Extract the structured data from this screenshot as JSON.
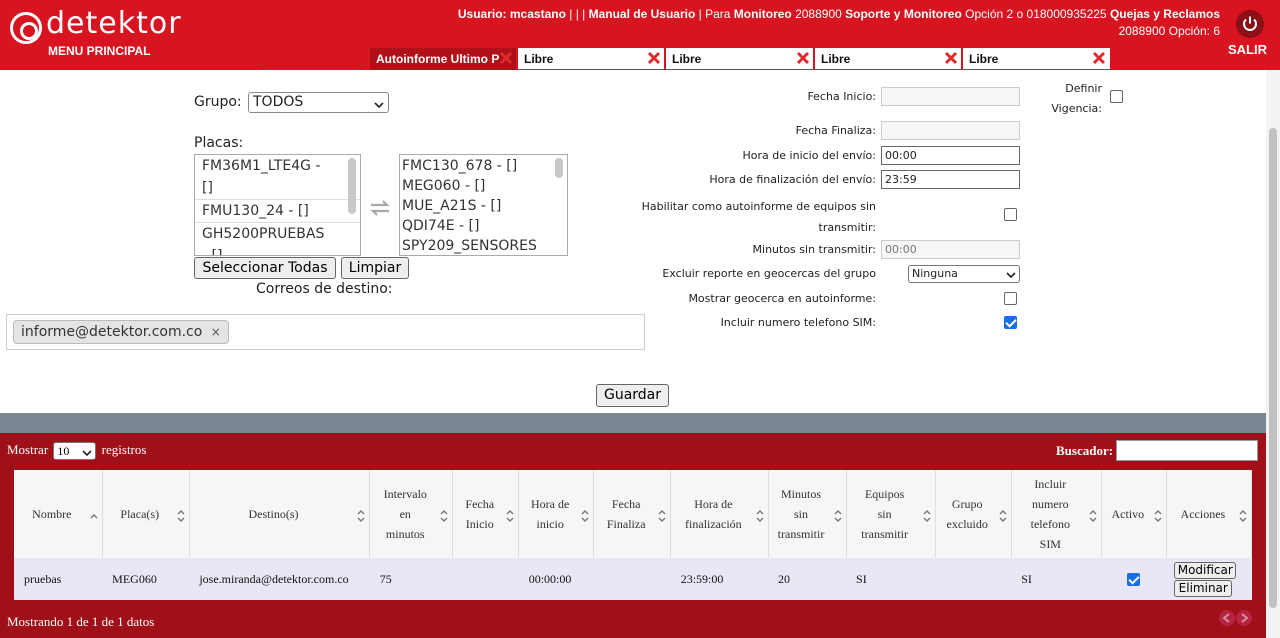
{
  "header": {
    "logo_text": "detektor",
    "menu_label": "MENU PRINCIPAL",
    "info_line1": [
      {
        "t": "Usuario: mcastano",
        "b": true
      },
      {
        "t": " | | | ",
        "b": false
      },
      {
        "t": "Manual de Usuario",
        "b": true
      },
      {
        "t": " | Para ",
        "b": false
      },
      {
        "t": "Monitoreo",
        "b": true
      },
      {
        "t": " 2088900 ",
        "b": false
      },
      {
        "t": "Soporte y Monitoreo",
        "b": true
      },
      {
        "t": " Opción 2 o 018000935225 ",
        "b": false
      },
      {
        "t": "Quejas y Reclamos",
        "b": true
      }
    ],
    "info_line2": "2088900 Opción: 6",
    "logout_label": "SALIR"
  },
  "tabs": [
    {
      "label": "Autoinforme Ultimo P"
    },
    {
      "label": "Libre"
    },
    {
      "label": "Libre"
    },
    {
      "label": "Libre"
    },
    {
      "label": "Libre"
    }
  ],
  "form": {
    "grupo_label": "Grupo:",
    "grupo_value": "TODOS",
    "placas_label": "Placas:",
    "available_plates": [
      "FM36M1_LTE4G -",
      "[]",
      "FMU130_24 - []",
      "GH5200PRUEBAS",
      "- []"
    ],
    "selected_plates": [
      "FMC130_678 - []",
      "MEG060 - []",
      "MUE_A21S - []",
      "QDI74E - []",
      "SPY209_SENSORES"
    ],
    "select_all_label": "Seleccionar Todas",
    "clear_label": "Limpiar",
    "correos_label": "Correos de destino:",
    "emails": [
      "informe@detektor.com.co"
    ],
    "chip_remove": "×",
    "save_label": "Guardar"
  },
  "settings": {
    "fecha_inicio_label": "Fecha Inicio:",
    "fecha_inicio_value": "",
    "definir_vigencia_label_1": "Definir",
    "definir_vigencia_label_2": "Vigencia:",
    "definir_vigencia_checked": false,
    "fecha_finaliza_label": "Fecha Finaliza:",
    "fecha_finaliza_value": "",
    "hora_inicio_label": "Hora de inicio del envío:",
    "hora_inicio_value": "00:00",
    "hora_fin_label": "Hora de finalización del envío:",
    "hora_fin_value": "23:59",
    "habilitar_label_1": "Habilitar como autoinforme de equipos sin",
    "habilitar_label_2": "transmitir:",
    "habilitar_checked": false,
    "minutos_label": "Minutos sin transmitir:",
    "minutos_value": "00:00",
    "excluir_label": "Excluir reporte en geocercas del grupo",
    "excluir_value": "Ninguna",
    "mostrar_geocerca_label": "Mostrar geocerca en autoinforme:",
    "mostrar_geocerca_checked": false,
    "incluir_sim_label": "Incluir numero telefono SIM:",
    "incluir_sim_checked": true
  },
  "table": {
    "mostrar_label": "Mostrar",
    "mostrar_value": "10",
    "registros_label": "registros",
    "buscador_label": "Buscador:",
    "columns": [
      [
        "Nombre"
      ],
      [
        "Placa(s)"
      ],
      [
        "Destino(s)"
      ],
      [
        "Intervalo",
        "en",
        "minutos"
      ],
      [
        "Fecha",
        "Inicio"
      ],
      [
        "Hora de",
        "inicio"
      ],
      [
        "Fecha",
        "Finaliza"
      ],
      [
        "Hora de",
        "finalización"
      ],
      [
        "Minutos",
        "sin",
        "transmitir"
      ],
      [
        "Equipos",
        "sin",
        "transmitir"
      ],
      [
        "Grupo",
        "excluido"
      ],
      [
        "Incluir",
        "numero",
        "telefono",
        "SIM"
      ],
      [
        "Activo"
      ],
      [
        "Acciones"
      ]
    ],
    "rows": [
      {
        "nombre": "pruebas",
        "placas": "MEG060",
        "destinos": "jose.miranda@detektor.com.co",
        "intervalo": "75",
        "fecha_inicio": "",
        "hora_inicio": "00:00:00",
        "fecha_finaliza": "",
        "hora_fin": "23:59:00",
        "minutos": "20",
        "equipos": "SI",
        "grupo": "",
        "incluir_sim": "SI",
        "activo": true,
        "modificar_label": "Modificar",
        "eliminar_label": "Eliminar"
      }
    ],
    "footer": "Mostrando 1 de 1 de 1 datos"
  },
  "colors": {
    "brand_red": "#d7141f",
    "panel_red": "#a01018",
    "checkbox_blue": "#1a6fe0"
  }
}
